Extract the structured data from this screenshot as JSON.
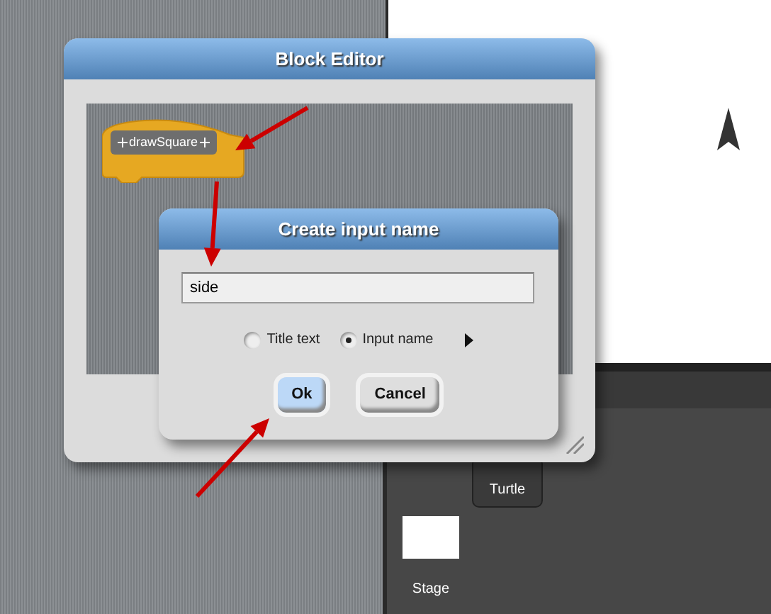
{
  "block_editor": {
    "title": "Block Editor",
    "block": {
      "label": "drawSquare"
    }
  },
  "dialog": {
    "title": "Create input name",
    "input": {
      "value": "side"
    },
    "options": [
      {
        "label": "Title text",
        "selected": false
      },
      {
        "label": "Input name",
        "selected": true
      }
    ],
    "buttons": [
      {
        "label": "Ok",
        "focused": true
      },
      {
        "label": "Cancel",
        "focused": false
      }
    ]
  },
  "sprites": [
    {
      "label": "Turtle"
    }
  ],
  "stage_thumb": {
    "label": "Stage"
  }
}
